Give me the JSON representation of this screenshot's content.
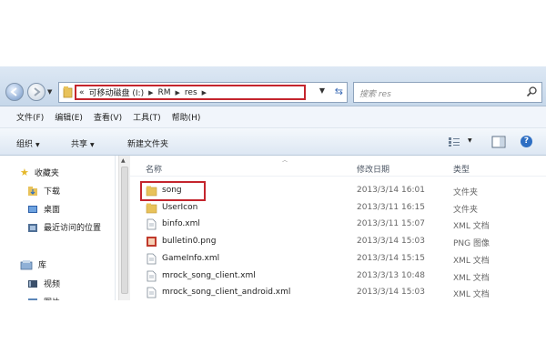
{
  "address_bar": {
    "overflow_marker": "«",
    "breadcrumbs": [
      "可移动磁盘 (I:)",
      "RM",
      "res"
    ],
    "search_placeholder": "搜索 res"
  },
  "menubar": {
    "items": [
      "文件(F)",
      "编辑(E)",
      "查看(V)",
      "工具(T)",
      "帮助(H)"
    ]
  },
  "command_bar": {
    "organize": "组织",
    "share": "共享",
    "new_folder": "新建文件夹"
  },
  "nav_pane": {
    "favorites_label": "收藏夹",
    "favorites": [
      "下载",
      "桌面",
      "最近访问的位置"
    ],
    "libraries_label": "库",
    "libraries": [
      "视频",
      "图片"
    ]
  },
  "file_list": {
    "columns": {
      "name": "名称",
      "date": "修改日期",
      "type": "类型"
    },
    "rows": [
      {
        "name": "song",
        "date": "2013/3/14 16:01",
        "type": "文件夹",
        "icon": "folder-icon",
        "highlighted": true
      },
      {
        "name": "UserIcon",
        "date": "2013/3/11 16:15",
        "type": "文件夹",
        "icon": "folder-icon"
      },
      {
        "name": "binfo.xml",
        "date": "2013/3/11 15:07",
        "type": "XML 文档",
        "icon": "xml-file-icon"
      },
      {
        "name": "bulletin0.png",
        "date": "2013/3/14 15:03",
        "type": "PNG 图像",
        "icon": "png-file-icon"
      },
      {
        "name": "GameInfo.xml",
        "date": "2013/3/14 15:15",
        "type": "XML 文档",
        "icon": "xml-file-icon"
      },
      {
        "name": "mrock_song_client.xml",
        "date": "2013/3/13 10:48",
        "type": "XML 文档",
        "icon": "xml-file-icon"
      },
      {
        "name": "mrock_song_client_android.xml",
        "date": "2013/3/14 15:03",
        "type": "XML 文档",
        "icon": "xml-file-icon"
      }
    ]
  },
  "colors": {
    "highlight_border": "#c4252d",
    "folder_yellow": "#e8c25a",
    "toolbar_blue": "#dde7f3"
  }
}
